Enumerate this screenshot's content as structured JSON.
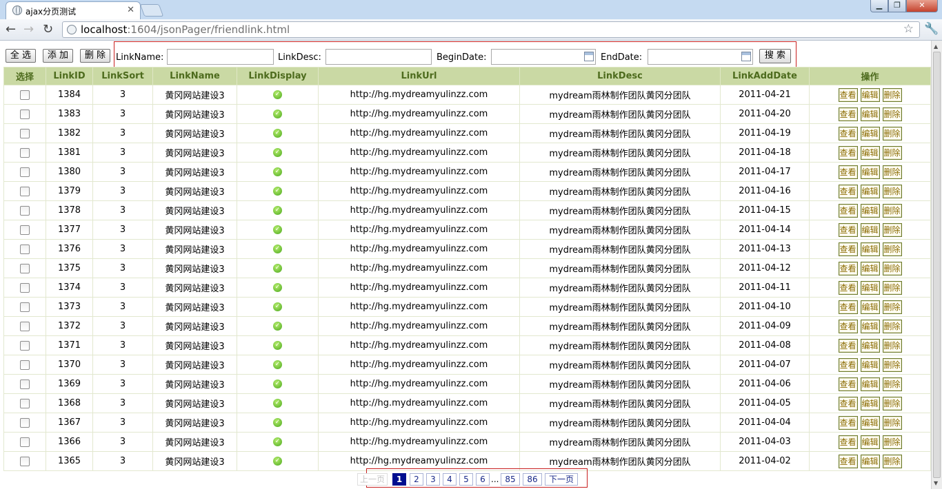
{
  "browser": {
    "tab_title": "ajax分页测试",
    "url_host": "localhost",
    "url_rest": ":1604/jsonPager/friendlink.html"
  },
  "buttons": {
    "select_all": "全 选",
    "add": "添 加",
    "delete": "删 除",
    "search": "搜 索"
  },
  "search": {
    "link_name_label": "LinkName:",
    "link_desc_label": "LinkDesc:",
    "begin_date_label": "BeginDate:",
    "end_date_label": "EndDate:",
    "link_name_value": "",
    "link_desc_value": "",
    "begin_date_value": "",
    "end_date_value": ""
  },
  "table": {
    "headers": [
      "选择",
      "LinkID",
      "LinkSort",
      "LinkName",
      "LinkDisplay",
      "LinkUrl",
      "LinkDesc",
      "LinkAddDate",
      "操作"
    ],
    "rows": [
      {
        "id": "1384",
        "sort": "3",
        "name": "黄冈网站建设3",
        "display": true,
        "url": "http://hg.mydreamyulinzz.com",
        "desc": "mydream雨林制作团队黄冈分团队",
        "date": "2011-04-21"
      },
      {
        "id": "1383",
        "sort": "3",
        "name": "黄冈网站建设3",
        "display": true,
        "url": "http://hg.mydreamyulinzz.com",
        "desc": "mydream雨林制作团队黄冈分团队",
        "date": "2011-04-20"
      },
      {
        "id": "1382",
        "sort": "3",
        "name": "黄冈网站建设3",
        "display": true,
        "url": "http://hg.mydreamyulinzz.com",
        "desc": "mydream雨林制作团队黄冈分团队",
        "date": "2011-04-19"
      },
      {
        "id": "1381",
        "sort": "3",
        "name": "黄冈网站建设3",
        "display": true,
        "url": "http://hg.mydreamyulinzz.com",
        "desc": "mydream雨林制作团队黄冈分团队",
        "date": "2011-04-18"
      },
      {
        "id": "1380",
        "sort": "3",
        "name": "黄冈网站建设3",
        "display": true,
        "url": "http://hg.mydreamyulinzz.com",
        "desc": "mydream雨林制作团队黄冈分团队",
        "date": "2011-04-17"
      },
      {
        "id": "1379",
        "sort": "3",
        "name": "黄冈网站建设3",
        "display": true,
        "url": "http://hg.mydreamyulinzz.com",
        "desc": "mydream雨林制作团队黄冈分团队",
        "date": "2011-04-16"
      },
      {
        "id": "1378",
        "sort": "3",
        "name": "黄冈网站建设3",
        "display": true,
        "url": "http://hg.mydreamyulinzz.com",
        "desc": "mydream雨林制作团队黄冈分团队",
        "date": "2011-04-15"
      },
      {
        "id": "1377",
        "sort": "3",
        "name": "黄冈网站建设3",
        "display": true,
        "url": "http://hg.mydreamyulinzz.com",
        "desc": "mydream雨林制作团队黄冈分团队",
        "date": "2011-04-14"
      },
      {
        "id": "1376",
        "sort": "3",
        "name": "黄冈网站建设3",
        "display": true,
        "url": "http://hg.mydreamyulinzz.com",
        "desc": "mydream雨林制作团队黄冈分团队",
        "date": "2011-04-13"
      },
      {
        "id": "1375",
        "sort": "3",
        "name": "黄冈网站建设3",
        "display": true,
        "url": "http://hg.mydreamyulinzz.com",
        "desc": "mydream雨林制作团队黄冈分团队",
        "date": "2011-04-12"
      },
      {
        "id": "1374",
        "sort": "3",
        "name": "黄冈网站建设3",
        "display": true,
        "url": "http://hg.mydreamyulinzz.com",
        "desc": "mydream雨林制作团队黄冈分团队",
        "date": "2011-04-11"
      },
      {
        "id": "1373",
        "sort": "3",
        "name": "黄冈网站建设3",
        "display": true,
        "url": "http://hg.mydreamyulinzz.com",
        "desc": "mydream雨林制作团队黄冈分团队",
        "date": "2011-04-10"
      },
      {
        "id": "1372",
        "sort": "3",
        "name": "黄冈网站建设3",
        "display": true,
        "url": "http://hg.mydreamyulinzz.com",
        "desc": "mydream雨林制作团队黄冈分团队",
        "date": "2011-04-09"
      },
      {
        "id": "1371",
        "sort": "3",
        "name": "黄冈网站建设3",
        "display": true,
        "url": "http://hg.mydreamyulinzz.com",
        "desc": "mydream雨林制作团队黄冈分团队",
        "date": "2011-04-08"
      },
      {
        "id": "1370",
        "sort": "3",
        "name": "黄冈网站建设3",
        "display": true,
        "url": "http://hg.mydreamyulinzz.com",
        "desc": "mydream雨林制作团队黄冈分团队",
        "date": "2011-04-07"
      },
      {
        "id": "1369",
        "sort": "3",
        "name": "黄冈网站建设3",
        "display": true,
        "url": "http://hg.mydreamyulinzz.com",
        "desc": "mydream雨林制作团队黄冈分团队",
        "date": "2011-04-06"
      },
      {
        "id": "1368",
        "sort": "3",
        "name": "黄冈网站建设3",
        "display": true,
        "url": "http://hg.mydreamyulinzz.com",
        "desc": "mydream雨林制作团队黄冈分团队",
        "date": "2011-04-05"
      },
      {
        "id": "1367",
        "sort": "3",
        "name": "黄冈网站建设3",
        "display": true,
        "url": "http://hg.mydreamyulinzz.com",
        "desc": "mydream雨林制作团队黄冈分团队",
        "date": "2011-04-04"
      },
      {
        "id": "1366",
        "sort": "3",
        "name": "黄冈网站建设3",
        "display": true,
        "url": "http://hg.mydreamyulinzz.com",
        "desc": "mydream雨林制作团队黄冈分团队",
        "date": "2011-04-03"
      },
      {
        "id": "1365",
        "sort": "3",
        "name": "黄冈网站建设3",
        "display": true,
        "url": "http://hg.mydreamyulinzz.com",
        "desc": "mydream雨林制作团队黄冈分团队",
        "date": "2011-04-02"
      }
    ],
    "actions": {
      "view": "查看",
      "edit": "编辑",
      "delete": "删除"
    }
  },
  "pager": {
    "prev": "上一页",
    "next": "下一页",
    "pages": [
      "1",
      "2",
      "3",
      "4",
      "5",
      "6"
    ],
    "ellipsis": "...",
    "tail_pages": [
      "85",
      "86"
    ],
    "current": "1"
  },
  "colors": {
    "header_bg": "#cad9a4",
    "header_text": "#4d6b1d",
    "highlight_border": "#c81e1e",
    "pager_current": "#000e8f"
  },
  "icons": {
    "display_yes": "green-check-circle-icon",
    "calendar": "calendar-icon"
  }
}
